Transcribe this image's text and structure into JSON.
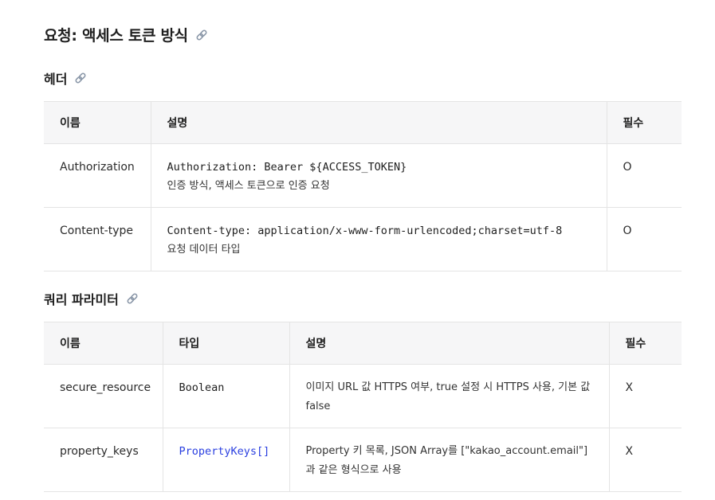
{
  "request_title": "요청: 액세스 토큰 방식",
  "headers": {
    "title": "헤더",
    "columns": [
      "이름",
      "설명",
      "필수"
    ],
    "rows": [
      {
        "name": "Authorization",
        "code": "Authorization: Bearer ${ACCESS_TOKEN}",
        "desc": "인증 방식, 액세스 토큰으로 인증 요청",
        "required": "O"
      },
      {
        "name": "Content-type",
        "code": "Content-type: application/x-www-form-urlencoded;charset=utf-8",
        "desc": "요청 데이터 타입",
        "required": "O"
      }
    ]
  },
  "query": {
    "title": "쿼리 파라미터",
    "columns": [
      "이름",
      "타입",
      "설명",
      "필수"
    ],
    "rows": [
      {
        "name": "secure_resource",
        "type": "Boolean",
        "desc": "이미지 URL 값 HTTPS 여부, true 설정 시 HTTPS 사용, 기본 값 false",
        "required": "X"
      },
      {
        "name": "property_keys",
        "type": "PropertyKeys[]",
        "desc": "Property 키 목록, JSON Array를 [\"kakao_account.email\"]과 같은 형식으로 사용",
        "required": "X"
      }
    ]
  },
  "icons": {
    "anchor": "link-icon"
  },
  "colors": {
    "link": "#2a3fe0",
    "header_bg": "#f6f6f7",
    "border": "#e4e4e4"
  }
}
